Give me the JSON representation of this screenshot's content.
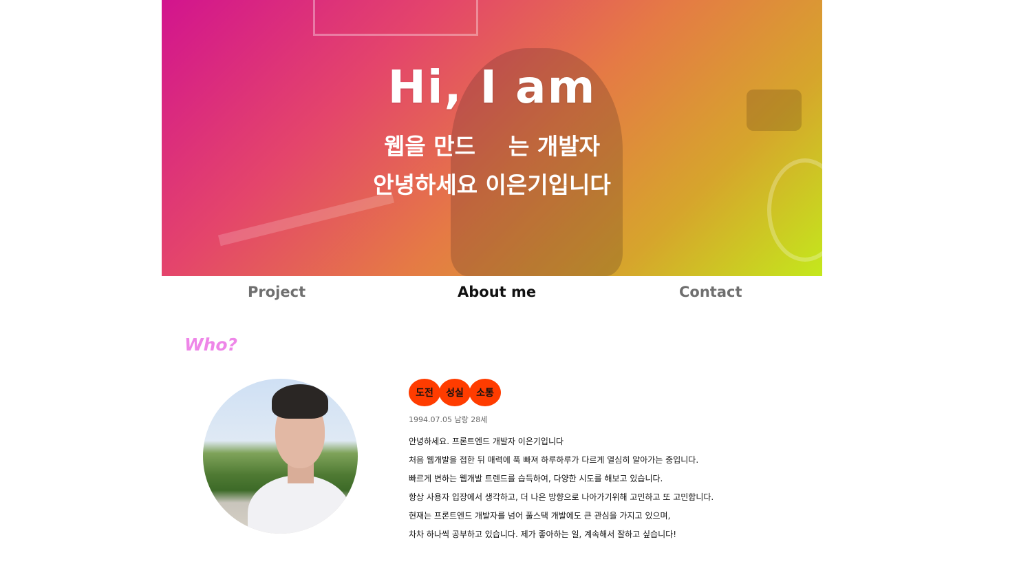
{
  "hero": {
    "title": "Hi, I am",
    "line1_a": "웹을 만드",
    "line1_b": "는 개발자",
    "line2": "안녕하세요 이은기입니다"
  },
  "nav": {
    "items": [
      {
        "label": "Project"
      },
      {
        "label": "About me"
      },
      {
        "label": "Contact"
      }
    ]
  },
  "about": {
    "heading": "Who?",
    "tags": [
      "도전",
      "성실",
      "소통"
    ],
    "birth": "1994.07.05 남랑 28세",
    "intro": [
      "안녕하세요. 프론트엔드 개발자 이은기입니다",
      "처음 웹개발을 접한 뒤 매력에 푹 빠져 하루하루가 다르게 열심히 알아가는 중입니다.",
      "빠르게 변하는 웹개발 트렌드를 습득하여, 다양한 시도를 해보고 있습니다.",
      "항상 사용자 입장에서 생각하고, 더 나은 방향으로 나아가기위해 고민하고 또 고민합니다.",
      "현재는 프론트엔드 개발자를 넘어 풀스택 개발에도 큰 관심을 가지고 있으며,",
      "차차 하나씩 공부하고 있습니다. 제가 좋아하는 일, 계속해서 잘하고 싶습니다!"
    ]
  },
  "colors": {
    "accent_tag": "#ff3c00",
    "who_heading": "#ee86e8",
    "hero_gradient_start": "#d2148e",
    "hero_gradient_end": "#c4e81c"
  }
}
